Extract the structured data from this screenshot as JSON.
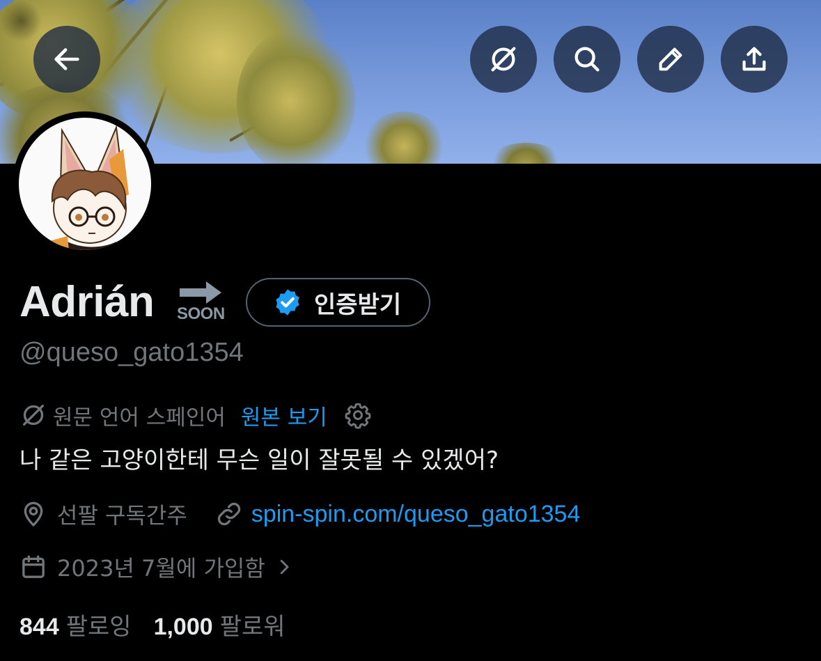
{
  "header": {
    "buttons": [
      {
        "name": "back-button",
        "icon": "arrow-left-icon"
      },
      {
        "name": "translate-toggle-button",
        "icon": "translate-off-icon"
      },
      {
        "name": "search-button",
        "icon": "search-icon"
      },
      {
        "name": "edit-button",
        "icon": "pencil-icon"
      },
      {
        "name": "share-button",
        "icon": "share-icon"
      }
    ]
  },
  "profile": {
    "display_name": "Adrián",
    "soon_badge": "SOON",
    "verify_label": "인증받기",
    "handle": "@queso_gato1354",
    "translation": {
      "language_text": "원문 언어 스페인어",
      "show_original": "원본 보기"
    },
    "bio": "나 같은 고양이한테 무슨 일이 잘못될 수 있겠어?",
    "location": "선팔 구독간주",
    "website": "spin-spin.com/queso_gato1354",
    "joined": "2023년 7월에 가입함",
    "following_count": "844",
    "following_label": "팔로잉",
    "followers_count": "1,000",
    "followers_label": "팔로워"
  },
  "colors": {
    "background": "#000000",
    "primary_text": "#e7e9ea",
    "secondary_text": "#71767b",
    "link": "#1d9bf0",
    "verified_badge": "#1d9bf0",
    "banner_sky": "#7a9cdc"
  }
}
